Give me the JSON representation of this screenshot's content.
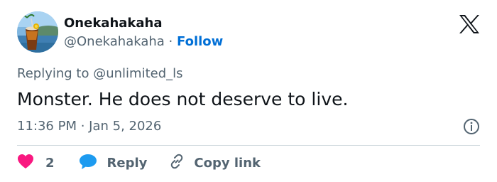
{
  "author": {
    "name": "Onekahakaha",
    "handle": "@Onekahakaha",
    "separator": "·",
    "follow_label": "Follow"
  },
  "reply_context": {
    "prefix": "Replying to",
    "mention": "@unlimited_ls"
  },
  "tweet": {
    "text": "Monster. He does not deserve to live.",
    "timestamp": "11:36 PM · Jan 5, 2026"
  },
  "actions": {
    "like_count": "2",
    "reply_label": "Reply",
    "copy_label": "Copy link"
  },
  "icons": {
    "brand": "x-logo-icon",
    "info": "info-icon",
    "like": "heart-icon",
    "reply": "speech-bubble-icon",
    "copy": "link-icon"
  },
  "colors": {
    "text": "#0f1419",
    "secondary": "#536471",
    "link": "#006fd6",
    "heart": "#f91880",
    "reply_bubble": "#1d9bf0",
    "divider": "#cfd9de"
  }
}
